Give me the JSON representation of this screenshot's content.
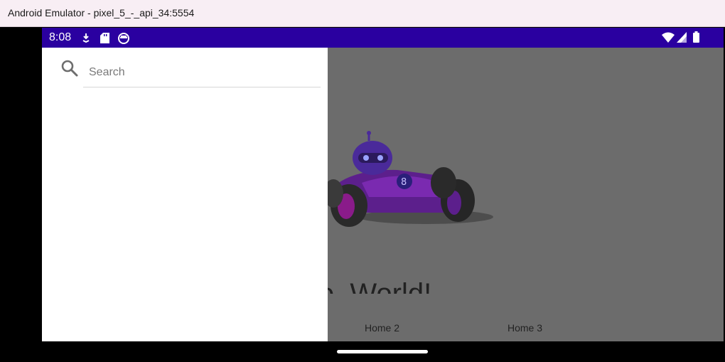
{
  "window": {
    "title": "Android Emulator - pixel_5_-_api_34:5554"
  },
  "status_bar": {
    "time": "8:08"
  },
  "app": {
    "greeting": "Hello, World!",
    "tabs": [
      {
        "label": "Home 2"
      },
      {
        "label": "Home 3"
      }
    ]
  },
  "drawer": {
    "search": {
      "placeholder": "Search",
      "value": ""
    }
  },
  "colors": {
    "status_bar": "#2a00a0",
    "scrim": "#6c6c6c",
    "drawer": "#ffffff",
    "title_bar": "#f8eef4"
  }
}
